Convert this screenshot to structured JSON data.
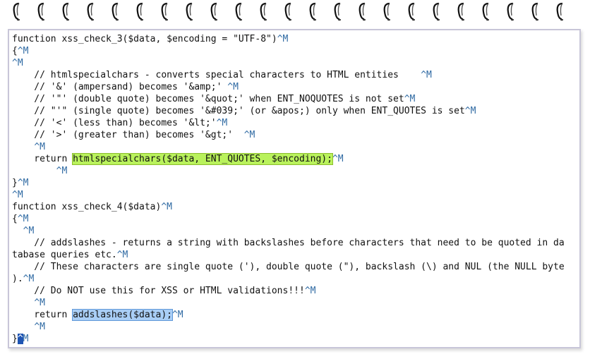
{
  "lines": [
    {
      "segments": [
        {
          "text": "function xss_check_3($data, $encoding = \"UTF-8\")"
        },
        {
          "text": "^M",
          "cls": "cr"
        }
      ]
    },
    {
      "segments": [
        {
          "text": "{"
        },
        {
          "text": "^M",
          "cls": "cr"
        }
      ]
    },
    {
      "segments": [
        {
          "text": "^M",
          "cls": "cr"
        }
      ]
    },
    {
      "segments": [
        {
          "text": "    // htmlspecialchars - converts special characters to HTML entities    "
        },
        {
          "text": "^M",
          "cls": "cr"
        }
      ]
    },
    {
      "segments": [
        {
          "text": "    // '&' (ampersand) becomes '&amp;' "
        },
        {
          "text": "^M",
          "cls": "cr"
        }
      ]
    },
    {
      "segments": [
        {
          "text": "    // '\"' (double quote) becomes '&quot;' when ENT_NOQUOTES is not set"
        },
        {
          "text": "^M",
          "cls": "cr"
        }
      ]
    },
    {
      "segments": [
        {
          "text": "    // \"'\" (single quote) becomes '&#039;' (or &apos;) only when ENT_QUOTES is set"
        },
        {
          "text": "^M",
          "cls": "cr"
        }
      ]
    },
    {
      "segments": [
        {
          "text": "    // '<' (less than) becomes '&lt;'"
        },
        {
          "text": "^M",
          "cls": "cr"
        }
      ]
    },
    {
      "segments": [
        {
          "text": "    // '>' (greater than) becomes '&gt;'  "
        },
        {
          "text": "^M",
          "cls": "cr"
        }
      ]
    },
    {
      "segments": [
        {
          "text": "    "
        },
        {
          "text": "^M",
          "cls": "cr"
        }
      ]
    },
    {
      "segments": [
        {
          "text": "    return "
        },
        {
          "text": "htmlspecialchars($data, ENT_QUOTES, $encoding);",
          "cls": "hl-green"
        },
        {
          "text": "^M",
          "cls": "cr"
        }
      ]
    },
    {
      "segments": [
        {
          "text": "        "
        },
        {
          "text": "^M",
          "cls": "cr"
        }
      ]
    },
    {
      "segments": [
        {
          "text": "}"
        },
        {
          "text": "^M",
          "cls": "cr"
        }
      ]
    },
    {
      "segments": [
        {
          "text": "^M",
          "cls": "cr"
        }
      ]
    },
    {
      "segments": [
        {
          "text": "function xss_check_4($data)"
        },
        {
          "text": "^M",
          "cls": "cr"
        }
      ]
    },
    {
      "segments": [
        {
          "text": "{"
        },
        {
          "text": "^M",
          "cls": "cr"
        }
      ]
    },
    {
      "segments": [
        {
          "text": "  "
        },
        {
          "text": "^M",
          "cls": "cr"
        }
      ]
    },
    {
      "segments": [
        {
          "text": "    // addslashes - returns a string with backslashes before characters that need to be quoted in da"
        }
      ]
    },
    {
      "segments": [
        {
          "text": "tabase queries etc."
        },
        {
          "text": "^M",
          "cls": "cr"
        }
      ]
    },
    {
      "segments": [
        {
          "text": "    // These characters are single quote ('), double quote (\"), backslash (\\) and NUL (the NULL byte"
        }
      ]
    },
    {
      "segments": [
        {
          "text": ")."
        },
        {
          "text": "^M",
          "cls": "cr"
        }
      ]
    },
    {
      "segments": [
        {
          "text": "    // Do NOT use this for XSS or HTML validations!!!"
        },
        {
          "text": "^M",
          "cls": "cr"
        }
      ]
    },
    {
      "segments": [
        {
          "text": "    "
        },
        {
          "text": "^M",
          "cls": "cr"
        }
      ]
    },
    {
      "segments": [
        {
          "text": "    return "
        },
        {
          "text": "addslashes($data);",
          "cls": "hl-blue"
        },
        {
          "text": "^M",
          "cls": "cr"
        }
      ]
    },
    {
      "segments": [
        {
          "text": "    "
        },
        {
          "text": "^M",
          "cls": "cr"
        }
      ]
    },
    {
      "segments": [
        {
          "text": "}"
        },
        {
          "text": "^",
          "cls": "cursor"
        },
        {
          "text": "M",
          "cls": "cr"
        }
      ]
    }
  ]
}
